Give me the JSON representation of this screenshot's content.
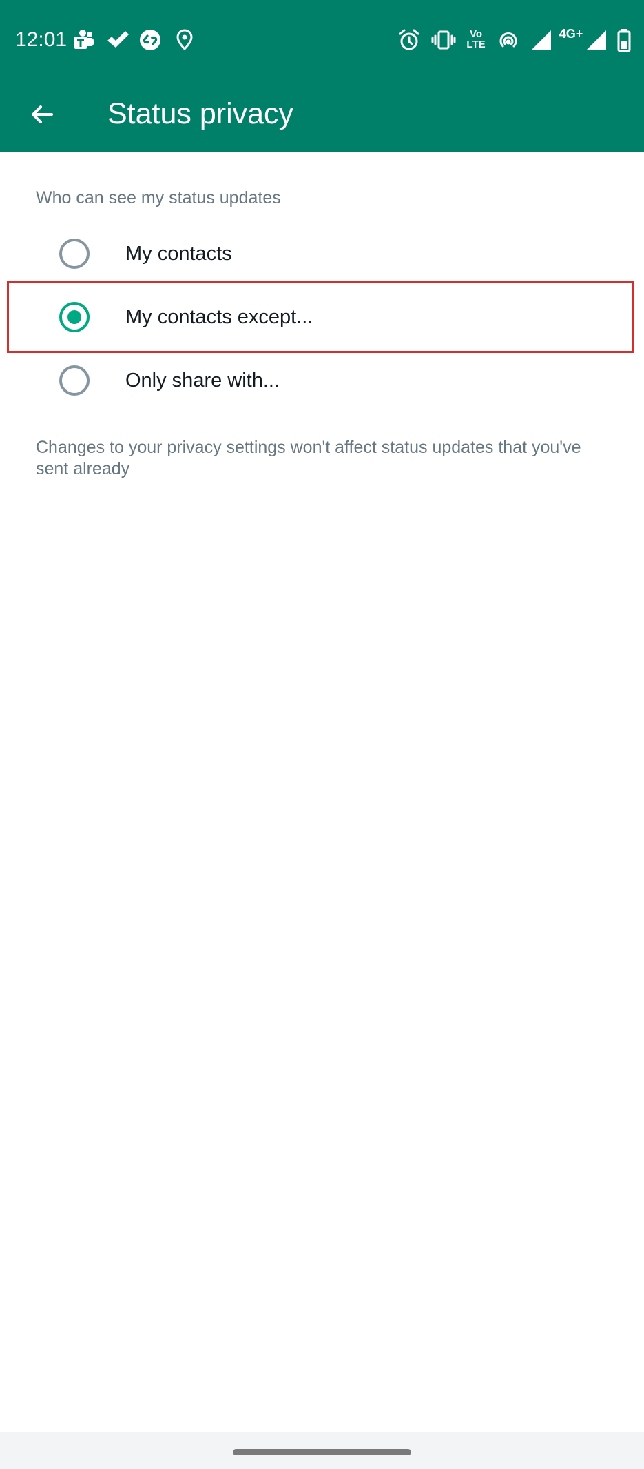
{
  "status_bar": {
    "time": "12:01",
    "volte_top": "Vo",
    "volte_bottom": "LTE",
    "network": "4G+",
    "left_icons": [
      "teams-icon",
      "check-icon",
      "shazam-icon",
      "location-icon"
    ],
    "right_icons": [
      "alarm-icon",
      "vibrate-icon",
      "volte-icon",
      "hotspot-icon",
      "signal-icon",
      "network-4g-icon",
      "signal-icon-2",
      "battery-icon"
    ]
  },
  "toolbar": {
    "back_icon": "arrow-left-icon",
    "title": "Status privacy"
  },
  "privacy": {
    "section_header": "Who can see my status updates",
    "options": [
      {
        "label": "My contacts",
        "selected": false
      },
      {
        "label": "My contacts except...",
        "selected": true
      },
      {
        "label": "Only share with...",
        "selected": false
      }
    ],
    "footer_note": "Changes to your privacy settings won't affect status updates that you've sent already"
  },
  "colors": {
    "app_bar": "#008069",
    "accent": "#00a884",
    "radio_unchecked": "#8696a0",
    "secondary_text": "#667781",
    "highlight": "#d32f2f"
  }
}
